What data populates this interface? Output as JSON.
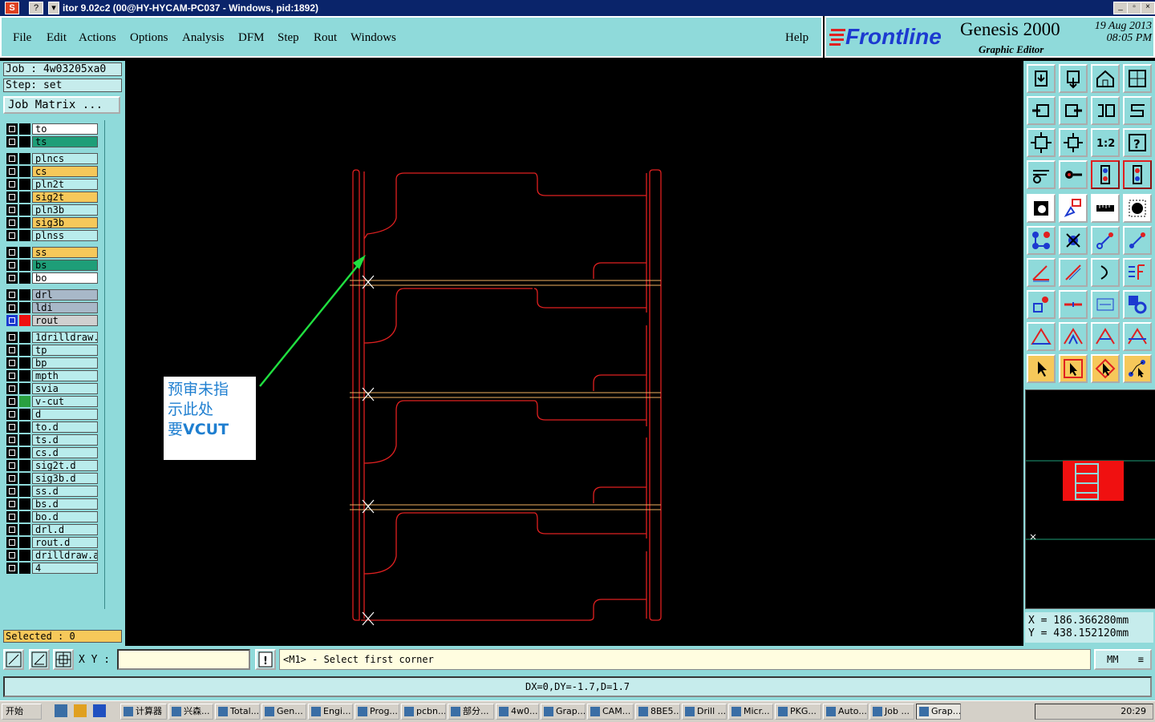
{
  "window": {
    "title": "itor 9.02c2 (00@HY-HYCAM-PC037 - Windows, pid:1892)",
    "sys_buttons": [
      "S",
      "?",
      "▾"
    ],
    "controls": [
      "_",
      "▫",
      "×"
    ]
  },
  "menu": [
    "File",
    "Edit",
    "Actions",
    "Options",
    "Analysis",
    "DFM",
    "Step",
    "Rout",
    "Windows"
  ],
  "help": "Help",
  "branding": {
    "logo": "Frontline",
    "product": "Genesis 2000",
    "editor": "Graphic Editor",
    "date": "19 Aug 2013",
    "time": "08:05 PM"
  },
  "job": {
    "job_line": "Job : 4w03205xa0",
    "step_line": "Step: set",
    "matrix_button": "Job Matrix ..."
  },
  "layers": [
    {
      "name": "to",
      "color": "#ffffff"
    },
    {
      "name": "ts",
      "color": "#1e9e78"
    },
    {
      "name": "plncs",
      "color": "#b9ecec"
    },
    {
      "name": "cs",
      "color": "#f6c85a"
    },
    {
      "name": "pln2t",
      "color": "#b9ecec"
    },
    {
      "name": "sig2t",
      "color": "#f6c85a"
    },
    {
      "name": "pln3b",
      "color": "#b9ecec"
    },
    {
      "name": "sig3b",
      "color": "#f6c85a"
    },
    {
      "name": "plnss",
      "color": "#b9ecec"
    },
    {
      "name": "ss",
      "color": "#f6c85a"
    },
    {
      "name": "bs",
      "color": "#1e9e78"
    },
    {
      "name": "bo",
      "color": "#ffffff"
    },
    {
      "name": "drl",
      "color": "#a8b8c8"
    },
    {
      "name": "ldi",
      "color": "#a8b8c8"
    },
    {
      "name": "rout",
      "color": "#d0d0d0"
    },
    {
      "name": "1drilldraw.a",
      "color": "#b9ecec"
    },
    {
      "name": "tp",
      "color": "#b9ecec"
    },
    {
      "name": "bp",
      "color": "#b9ecec"
    },
    {
      "name": "mpth",
      "color": "#b9ecec"
    },
    {
      "name": "svia",
      "color": "#b9ecec"
    },
    {
      "name": "v-cut",
      "color": "#b9ecec"
    },
    {
      "name": "d",
      "color": "#b9ecec"
    },
    {
      "name": "to.d",
      "color": "#b9ecec"
    },
    {
      "name": "ts.d",
      "color": "#b9ecec"
    },
    {
      "name": "cs.d",
      "color": "#b9ecec"
    },
    {
      "name": "sig2t.d",
      "color": "#b9ecec"
    },
    {
      "name": "sig3b.d",
      "color": "#b9ecec"
    },
    {
      "name": "ss.d",
      "color": "#b9ecec"
    },
    {
      "name": "bs.d",
      "color": "#b9ecec"
    },
    {
      "name": "bo.d",
      "color": "#b9ecec"
    },
    {
      "name": "drl.d",
      "color": "#b9ecec"
    },
    {
      "name": "rout.d",
      "color": "#b9ecec"
    },
    {
      "name": "drilldraw.ar",
      "color": "#b9ecec"
    },
    {
      "name": "4",
      "color": "#b9ecec"
    }
  ],
  "selected": "Selected : 0",
  "annotation": {
    "line1": "预审未指",
    "line2": "示此处",
    "line3_prefix": "要",
    "line3_suffix": "VCUT"
  },
  "coords": {
    "x": "X = 186.366280mm",
    "y": "Y = 438.152120mm"
  },
  "command": {
    "xy_label": "X Y :",
    "xy_value": "",
    "prompt_icon": "!",
    "prompt": "<M1> - Select first corner",
    "units": "MM"
  },
  "status": "DX=0,DY=-1.7,D=1.7",
  "taskbar": {
    "start": "开始",
    "items": [
      "计算器",
      "兴森...",
      "Total...",
      "Gen...",
      "Engi...",
      "Prog...",
      "pcbn...",
      "部分...",
      "4w0...",
      "Grap...",
      "CAM...",
      "8BE5...",
      "Drill ...",
      "Micr...",
      "PKG...",
      "Auto...",
      "Job ...",
      "Grap..."
    ],
    "clock": "20:29"
  },
  "colors": {
    "panel": "#8fdada",
    "rout_line": "#e02020",
    "vcut_line": "#f0b060",
    "arrow": "#20e040",
    "annotation_text": "#1f7fd0"
  }
}
